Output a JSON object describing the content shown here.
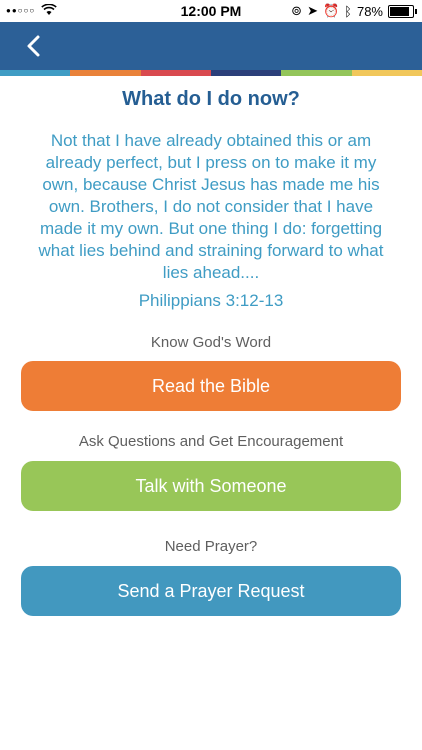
{
  "status_bar": {
    "signal": "●●○○○",
    "time": "12:00 PM",
    "battery": "78%",
    "battery_level": 0.78
  },
  "nav": {
    "back_icon": "chevron-left-icon",
    "bar_color": "#2c6097",
    "stripe_colors": [
      "#3f9cc4",
      "#e9823a",
      "#d94a4f",
      "#2b3f7a",
      "#93c55a",
      "#f1c75b"
    ]
  },
  "content": {
    "title": "What do I do now?",
    "verse_lines": [
      "Not that I have already obtained this or am",
      "already perfect, but I press on to make it my",
      "own, because Christ Jesus has made me his",
      "own. Brothers, I do not consider that I have",
      "made it my own. But one thing I do: forgetting",
      "what lies behind and straining forward to what",
      "lies ahead...."
    ],
    "reference": "Philippians 3:12-13"
  },
  "actions": [
    {
      "label": "Know God's Word",
      "button": "Read the Bible",
      "color": "#ee7d36"
    },
    {
      "label": "Ask Questions and Get Encouragement",
      "button": "Talk with Someone",
      "color": "#98c658"
    },
    {
      "label": "Need Prayer?",
      "button": "Send a Prayer Request",
      "color": "#4298bf"
    }
  ]
}
